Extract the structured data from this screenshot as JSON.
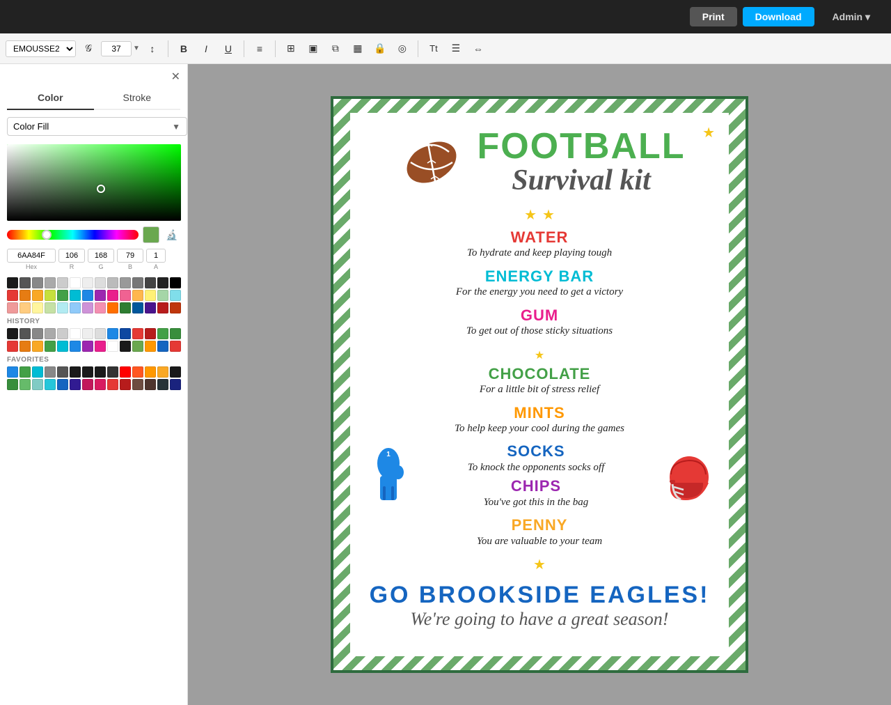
{
  "topbar": {
    "print_label": "Print",
    "download_label": "Download",
    "admin_label": "Admin ▾"
  },
  "toolbar": {
    "font_name": "EMOUSSE2",
    "font_size": "37",
    "bold_label": "B",
    "italic_label": "I",
    "underline_label": "U"
  },
  "left_panel": {
    "close_icon": "✕",
    "color_tab": "Color",
    "stroke_tab": "Stroke",
    "fill_type": "Color Fill",
    "hex_value": "6AA84F",
    "r_value": "106",
    "g_value": "168",
    "b_value": "79",
    "a_value": "1",
    "hex_label": "Hex",
    "r_label": "R",
    "g_label": "G",
    "b_label": "B",
    "a_label": "A",
    "history_label": "HISTORY",
    "favorites_label": "FAVORITES"
  },
  "poster": {
    "title_football": "FOOTBALL",
    "title_survival": "Survival kit",
    "items": [
      {
        "name": "WATER",
        "desc": "To hydrate and keep playing tough",
        "color": "red"
      },
      {
        "name": "ENERGY BAR",
        "desc": "For the energy you need to get a victory",
        "color": "cyan"
      },
      {
        "name": "GUM",
        "desc": "To get out of those sticky situations",
        "color": "magenta"
      },
      {
        "name": "CHOCOLATE",
        "desc": "For a little bit of stress relief",
        "color": "green"
      },
      {
        "name": "MINTS",
        "desc": "To help keep your cool during the games",
        "color": "orange"
      },
      {
        "name": "SOCKS",
        "desc": "To knock the opponents socks off",
        "color": "blue"
      },
      {
        "name": "CHIPS",
        "desc": "You've got this in the bag",
        "color": "purple"
      },
      {
        "name": "PENNY",
        "desc": "You are valuable to your team",
        "color": "yellow"
      }
    ],
    "go_text": "GO  BROOKSIDE  EAGLES!",
    "season_text": "We're going to have a great season!"
  },
  "swatches": {
    "history": [
      "#1a1a1a",
      "#555555",
      "#888888",
      "#aaaaaa",
      "#cccccc",
      "#ffffff",
      "#eeeeee",
      "#dddddd",
      "#1e88e5",
      "#0d47a1",
      "#e53935",
      "#b71c1c",
      "#43a047",
      "#388e3c",
      "#e53935",
      "#e67c13",
      "#f9a825",
      "#43a047",
      "#00bcd4",
      "#1e88e5",
      "#9c27b0",
      "#e91e8c",
      "#ffffff",
      "#1a1a1a",
      "#6AA84F",
      "#ff9800",
      "#1565c0",
      "#e53935"
    ],
    "favorites": [
      "#1e88e5",
      "#43a047",
      "#00bcd4",
      "#888888",
      "#555555",
      "#1a1a1a",
      "#1a1a1a",
      "#1a1a1a",
      "#333333",
      "#ff0000",
      "#ff5722",
      "#ff9800",
      "#f9a825",
      "#1a1a1a",
      "#388e3c",
      "#66bb6a",
      "#80cbc4",
      "#26c6da",
      "#1565c0",
      "#311b92",
      "#c2185b",
      "#d81b60",
      "#e53935",
      "#b71c1c",
      "#6d4c41",
      "#4e342e",
      "#263238",
      "#1a237e"
    ]
  }
}
